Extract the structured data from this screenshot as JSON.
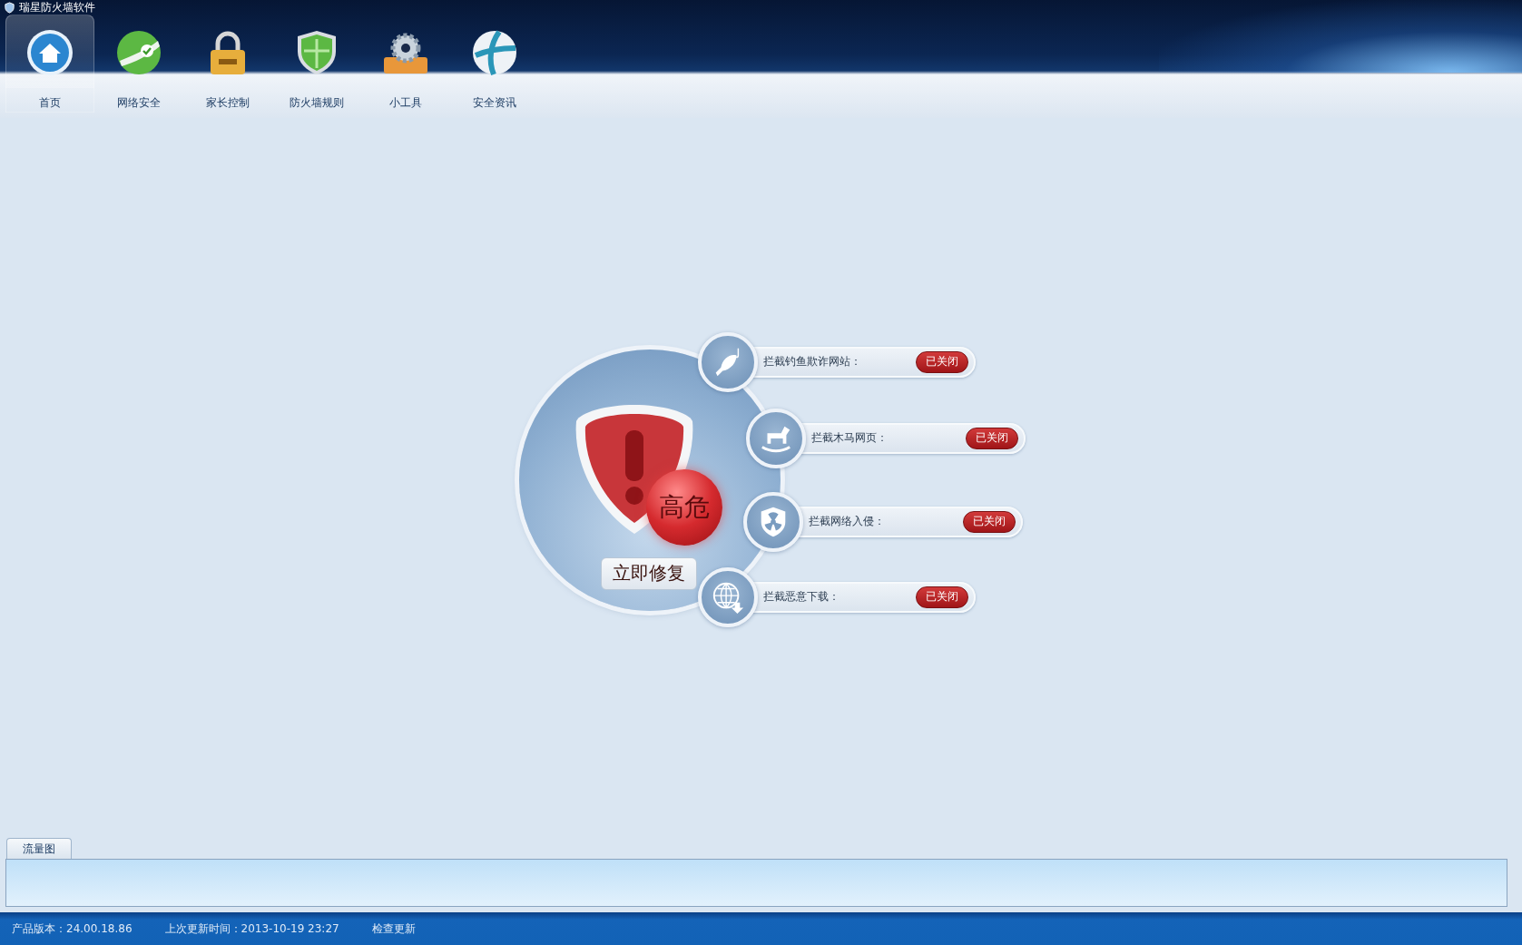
{
  "window": {
    "title": "瑞星防火墙软件"
  },
  "nav": [
    {
      "label": "首页",
      "kind": "home",
      "selected": true
    },
    {
      "label": "网络安全",
      "kind": "globe-check",
      "selected": false
    },
    {
      "label": "家长控制",
      "kind": "lock",
      "selected": false
    },
    {
      "label": "防火墙规则",
      "kind": "shield",
      "selected": false
    },
    {
      "label": "小工具",
      "kind": "gear",
      "selected": false
    },
    {
      "label": "安全资讯",
      "kind": "sphere",
      "selected": false
    }
  ],
  "status_panel": {
    "risk": "高危",
    "fix_button": "立即修复"
  },
  "protections": [
    {
      "kind": "fish",
      "label": "拦截钓鱼欺诈网站：",
      "status": "已关闭",
      "on": false
    },
    {
      "kind": "horse",
      "label": "拦截木马网页：",
      "status": "已关闭",
      "on": false
    },
    {
      "kind": "radiation",
      "label": "拦截网络入侵：",
      "status": "已关闭",
      "on": false
    },
    {
      "kind": "download",
      "label": "拦截恶意下载：",
      "status": "已关闭",
      "on": false
    }
  ],
  "traffic": {
    "tab": "流量图"
  },
  "status_bar": {
    "version": "产品版本：24.00.18.86",
    "last_update": "上次更新时间：2013-10-19 23:27",
    "check_update": "检查更新"
  }
}
